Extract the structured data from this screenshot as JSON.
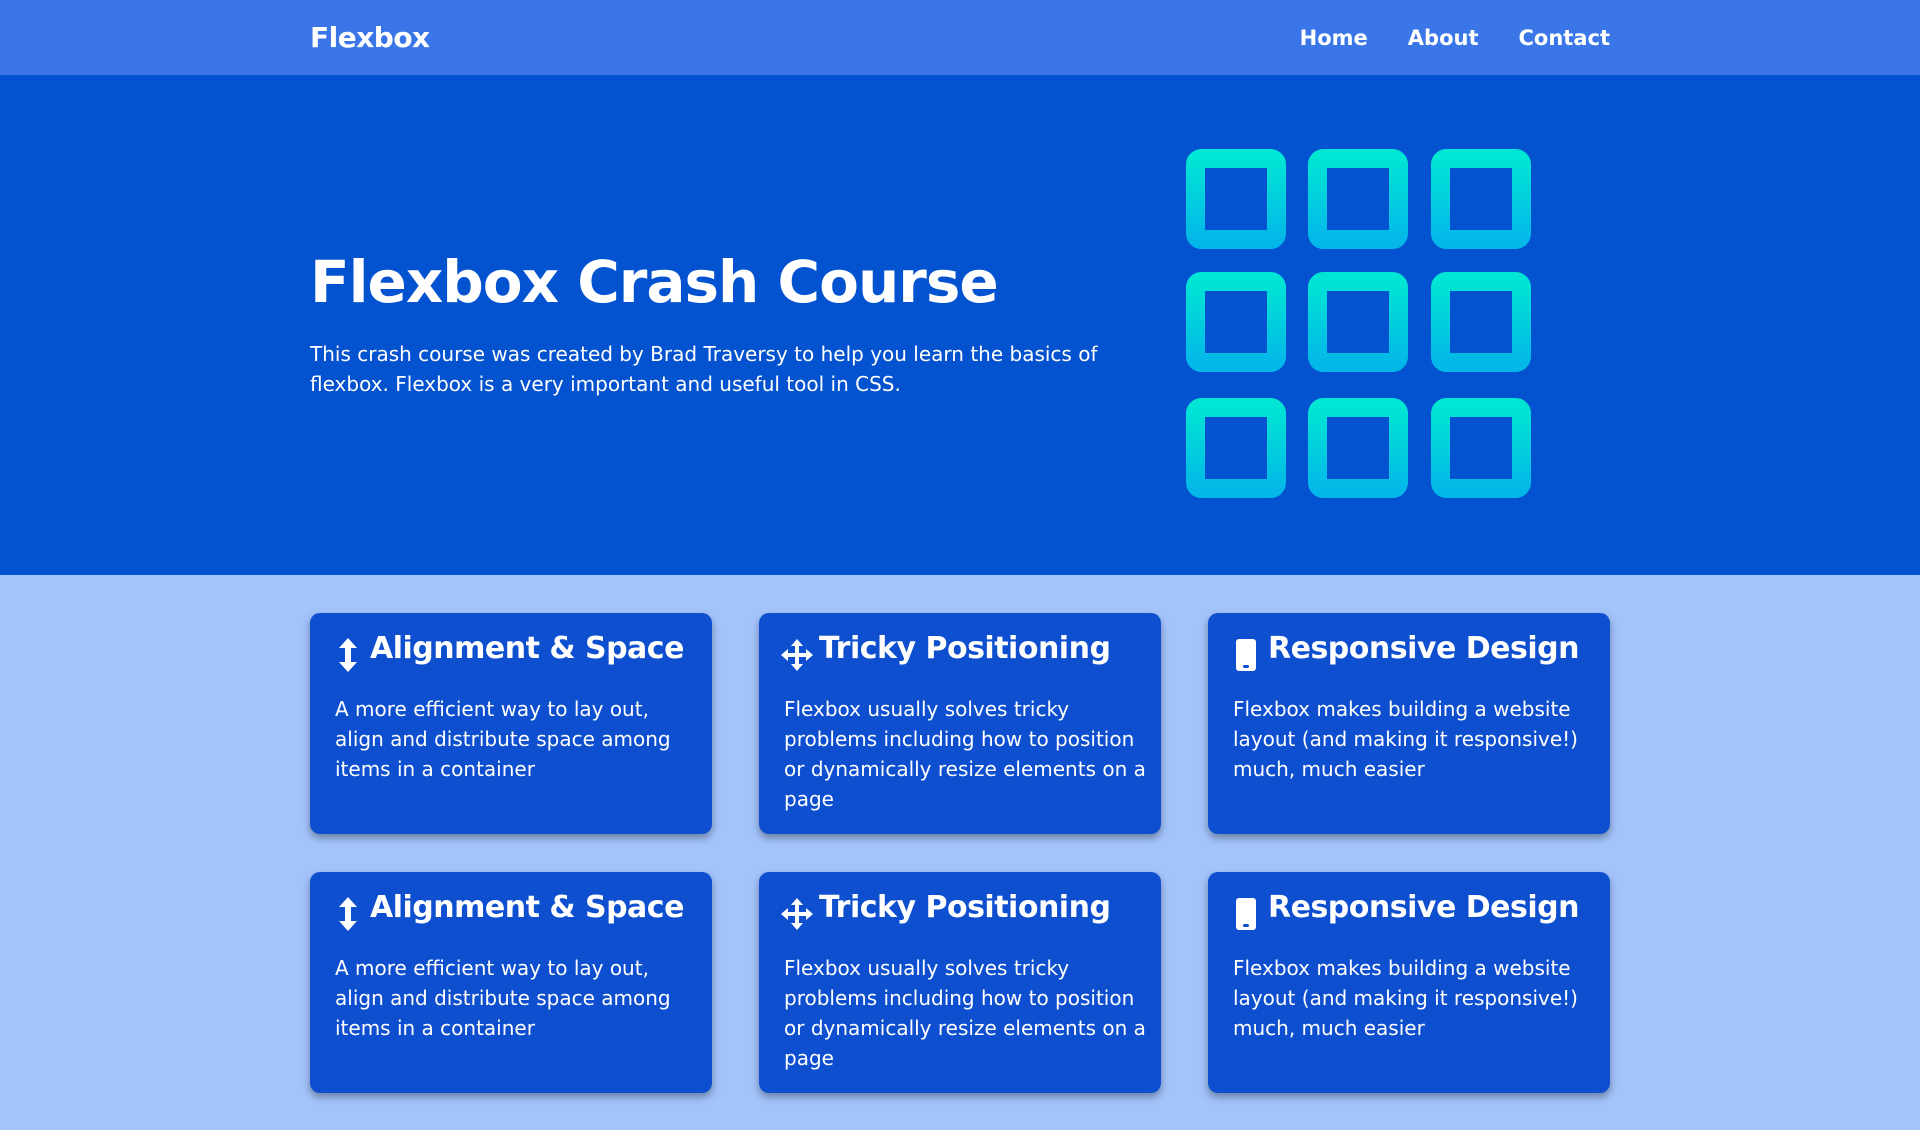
{
  "navbar": {
    "brand": "Flexbox",
    "links": [
      "Home",
      "About",
      "Contact"
    ]
  },
  "hero": {
    "title": "Flexbox Crash Course",
    "description": "This crash course was created by Brad Traversy to help you learn the basics of flexbox. Flexbox is a very important and useful tool in CSS."
  },
  "cards": [
    {
      "icon": "arrows-vertical-icon",
      "title": "Alignment & Space",
      "text": "A more efficient way to lay out, align and distribute space among items in a container"
    },
    {
      "icon": "arrows-move-icon",
      "title": "Tricky Positioning",
      "text": "Flexbox usually solves tricky problems including how to position or dynamically resize elements on a page"
    },
    {
      "icon": "mobile-phone-icon",
      "title": "Responsive Design",
      "text": "Flexbox makes building a website layout (and making it responsive!) much, much easier"
    },
    {
      "icon": "arrows-vertical-icon",
      "title": "Alignment & Space",
      "text": "A more efficient way to lay out, align and distribute space among items in a container"
    },
    {
      "icon": "arrows-move-icon",
      "title": "Tricky Positioning",
      "text": "Flexbox usually solves tricky problems including how to position or dynamically resize elements on a page"
    },
    {
      "icon": "mobile-phone-icon",
      "title": "Responsive Design",
      "text": "Flexbox makes building a website layout (and making it responsive!) much, much easier"
    }
  ],
  "colors": {
    "navbar": "#3a76e8",
    "hero": "#0352d0",
    "page_background": "#a3c3fb",
    "card": "#0d4fcf",
    "grid_gradient_top": "#00e5d4",
    "grid_gradient_bottom": "#03b8e8"
  }
}
